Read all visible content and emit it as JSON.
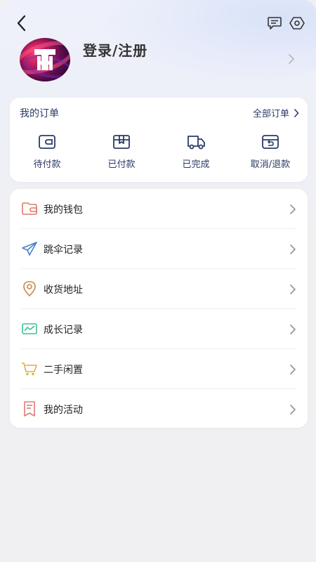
{
  "profile": {
    "login_label": "登录/注册"
  },
  "orders": {
    "title": "我的订单",
    "all_label": "全部订单",
    "items": [
      {
        "label": "待付款",
        "icon": "wallet-icon"
      },
      {
        "label": "已付款",
        "icon": "package-box-icon"
      },
      {
        "label": "已完成",
        "icon": "delivery-truck-icon"
      },
      {
        "label": "取消/退款",
        "icon": "refund-box-icon"
      }
    ]
  },
  "menu": {
    "items": [
      {
        "label": "我的钱包",
        "icon": "wallet-icon",
        "color": "#e07a6a"
      },
      {
        "label": "跳伞记录",
        "icon": "paper-plane-icon",
        "color": "#4a7fc8"
      },
      {
        "label": "收货地址",
        "icon": "location-pin-icon",
        "color": "#c88a4a"
      },
      {
        "label": "成长记录",
        "icon": "chart-wave-icon",
        "color": "#3fbf9a"
      },
      {
        "label": "二手闲置",
        "icon": "shopping-cart-icon",
        "color": "#e0b040"
      },
      {
        "label": "我的活动",
        "icon": "bookmark-document-icon",
        "color": "#e07a7a"
      }
    ]
  },
  "colors": {
    "accent_navy": "#2b3a67",
    "background": "#f0f0f3",
    "card": "#ffffff"
  }
}
